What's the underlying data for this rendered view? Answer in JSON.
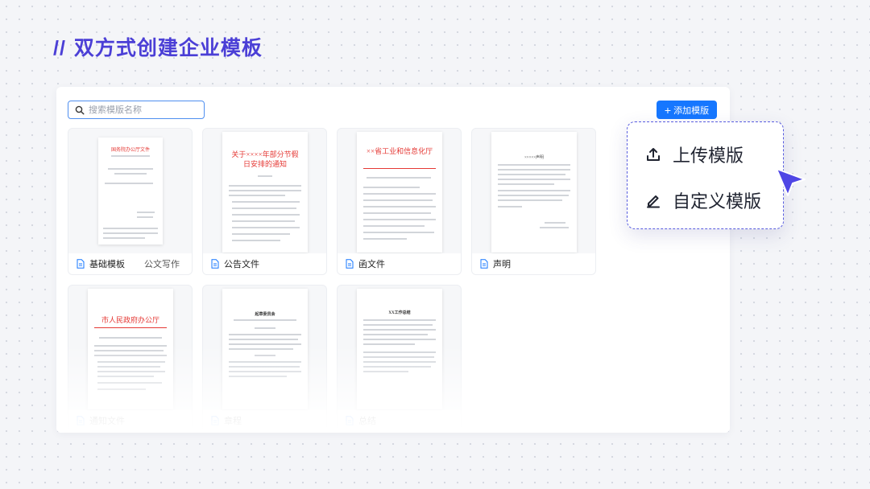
{
  "title": {
    "slash": "//",
    "text": "双方式创建企业模板"
  },
  "search": {
    "placeholder": "搜索模版名称",
    "icon": "search-icon"
  },
  "add_button": {
    "label": "添加模版",
    "icon": "plus-icon"
  },
  "colors": {
    "accent": "#1677ff",
    "title": "#4b3fd6",
    "popup_border": "#5a5ee0",
    "red_header": "#e53935"
  },
  "templates": [
    {
      "name": "基础模板",
      "tag": "公文写作",
      "preview_title": "国务院办公厅文件"
    },
    {
      "name": "公告文件",
      "tag": "",
      "preview_title": "关于××××年部分节假日安排的通知"
    },
    {
      "name": "函文件",
      "tag": "",
      "preview_title": "××省工业和信息化厅"
    },
    {
      "name": "声明",
      "tag": "",
      "preview_title": "×××××声明"
    },
    {
      "name": "通知文件",
      "tag": "",
      "preview_title": "市人民政府办公厅"
    },
    {
      "name": "章程",
      "tag": "",
      "preview_title": "起草委员会"
    },
    {
      "name": "总结",
      "tag": "",
      "preview_title": "XX工作总结"
    }
  ],
  "popup": {
    "upload": {
      "label": "上传模版",
      "icon": "upload-icon"
    },
    "custom": {
      "label": "自定义模版",
      "icon": "edit-pencil-icon"
    }
  },
  "cursor": {
    "icon": "pointer-cursor-icon"
  }
}
